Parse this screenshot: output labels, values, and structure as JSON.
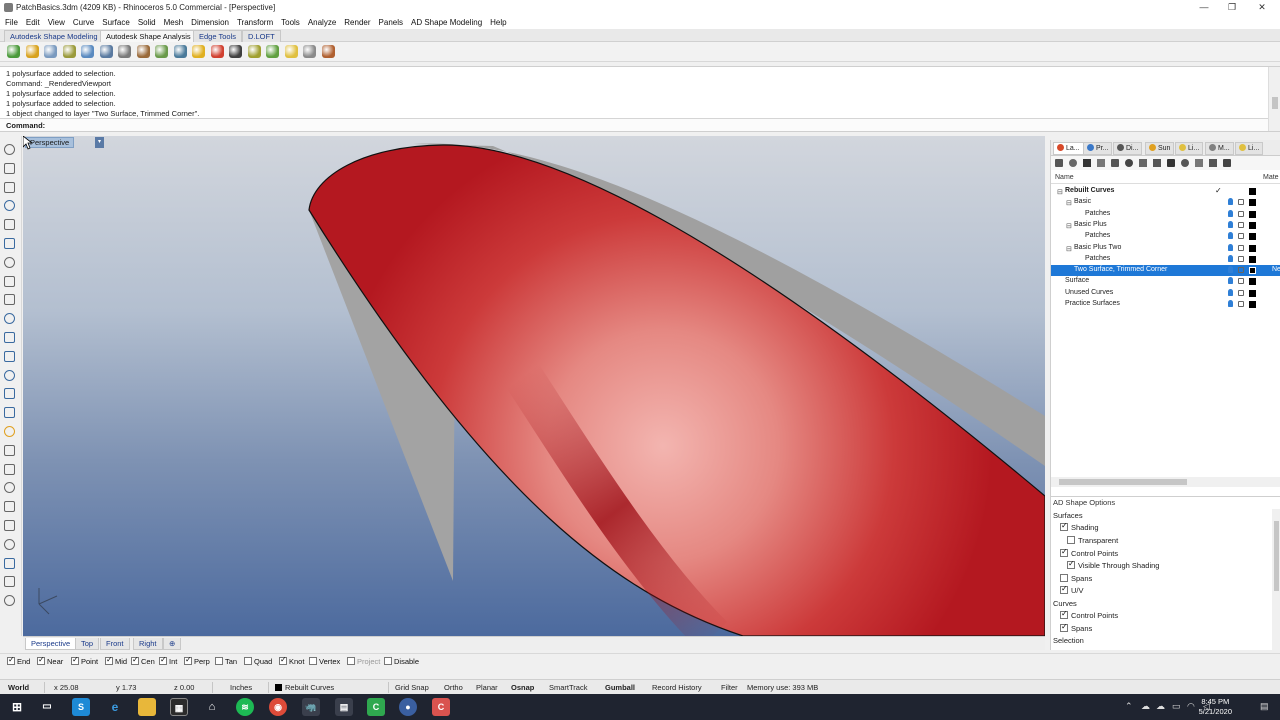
{
  "window": {
    "title": "PatchBasics.3dm (4209 KB) - Rhinoceros 5.0 Commercial - [Perspective]",
    "minimize": "—",
    "maximize": "❐",
    "close": "✕"
  },
  "menu": [
    "File",
    "Edit",
    "View",
    "Curve",
    "Surface",
    "Solid",
    "Mesh",
    "Dimension",
    "Transform",
    "Tools",
    "Analyze",
    "Render",
    "Panels",
    "AD Shape Modeling",
    "Help"
  ],
  "toolbar_tabs": [
    {
      "label": "Autodesk Shape Modeling",
      "active": false
    },
    {
      "label": "Autodesk Shape Analysis",
      "active": true
    },
    {
      "label": "Edge Tools",
      "active": false
    },
    {
      "label": "D.LOFT",
      "active": false
    }
  ],
  "command_history": [
    "1 polysurface added to selection.",
    "Command: _RenderedViewport",
    "1 polysurface added to selection.",
    "1 polysurface added to selection.",
    "1 object changed to layer \"Two Surface, Trimmed Corner\"."
  ],
  "command_prompt": "Command:",
  "viewport": {
    "label": "Perspective",
    "menu_arrow": "▾",
    "surface_color": "#b5141c",
    "side_color": "#9e9e9e"
  },
  "viewport_tabs": [
    {
      "label": "Perspective",
      "active": true
    },
    {
      "label": "Top",
      "active": false
    },
    {
      "label": "Front",
      "active": false
    },
    {
      "label": "Right",
      "active": false
    },
    {
      "label": "⊕",
      "active": false
    }
  ],
  "osnaps": [
    {
      "label": "End",
      "checked": true
    },
    {
      "label": "Near",
      "checked": true
    },
    {
      "label": "Point",
      "checked": true
    },
    {
      "label": "Mid",
      "checked": true
    },
    {
      "label": "Cen",
      "checked": true
    },
    {
      "label": "Int",
      "checked": true
    },
    {
      "label": "Perp",
      "checked": true
    },
    {
      "label": "Tan",
      "checked": false
    },
    {
      "label": "Quad",
      "checked": false
    },
    {
      "label": "Knot",
      "checked": true
    },
    {
      "label": "Vertex",
      "checked": false
    },
    {
      "label": "Project",
      "checked": false,
      "disabled": true
    },
    {
      "label": "Disable",
      "checked": false
    }
  ],
  "status": {
    "cplane": "World",
    "x": "x 25.08",
    "y": "y 1.73",
    "z": "z 0.00",
    "units": "Inches",
    "layer": "Rebuilt Curves",
    "grid_snap": "Grid Snap",
    "ortho": "Ortho",
    "planar": "Planar",
    "osnap": "Osnap",
    "smarttrack": "SmartTrack",
    "gumball": "Gumball",
    "record_history": "Record History",
    "filter": "Filter",
    "memory": "Memory use: 393 MB"
  },
  "panel_tabs": [
    {
      "label": "La...",
      "color": "#d84a2a",
      "active": true
    },
    {
      "label": "Pr...",
      "color": "#3a78c8",
      "active": false
    },
    {
      "label": "Di...",
      "color": "#555555",
      "active": false
    },
    {
      "label": "Sun",
      "color": "#e0a020",
      "active": false
    },
    {
      "label": "Li...",
      "color": "#e0c040",
      "active": false
    },
    {
      "label": "M...",
      "color": "#808080",
      "active": false
    },
    {
      "label": "Li...",
      "color": "#e0c040",
      "active": false
    }
  ],
  "layers": {
    "columns": {
      "name": "Name",
      "material": "Mate"
    },
    "rows": [
      {
        "name": "Rebuilt Curves",
        "level": 0,
        "toggle": "⊟",
        "bold": true,
        "current": true,
        "selected": false
      },
      {
        "name": "Basic",
        "level": 1,
        "toggle": "⊟",
        "bold": false,
        "current": false,
        "selected": false
      },
      {
        "name": "Patches",
        "level": 2,
        "toggle": "",
        "bold": false,
        "current": false,
        "selected": false
      },
      {
        "name": "Basic Plus",
        "level": 1,
        "toggle": "⊟",
        "bold": false,
        "current": false,
        "selected": false
      },
      {
        "name": "Patches",
        "level": 2,
        "toggle": "",
        "bold": false,
        "current": false,
        "selected": false
      },
      {
        "name": "Basic Plus Two",
        "level": 1,
        "toggle": "⊟",
        "bold": false,
        "current": false,
        "selected": false
      },
      {
        "name": "Patches",
        "level": 2,
        "toggle": "",
        "bold": false,
        "current": false,
        "selected": false
      },
      {
        "name": "Two Surface, Trimmed Corner",
        "level": 1,
        "toggle": "",
        "bold": false,
        "current": false,
        "selected": true
      },
      {
        "name": "Surface",
        "level": 0,
        "toggle": "",
        "bold": false,
        "current": false,
        "selected": false
      },
      {
        "name": "Unused Curves",
        "level": 0,
        "toggle": "",
        "bold": false,
        "current": false,
        "selected": false
      },
      {
        "name": "Practice Surfaces",
        "level": 0,
        "toggle": "",
        "bold": false,
        "current": false,
        "selected": false
      }
    ],
    "current_mark": "✓",
    "selected_material": "Ne"
  },
  "ad_shape_options": {
    "title": "AD Shape Options",
    "sections": [
      {
        "label": "Surfaces",
        "options": [
          {
            "label": "Shading",
            "checked": true,
            "indent": 0
          },
          {
            "label": "Transparent",
            "checked": false,
            "indent": 1
          },
          {
            "label": "Control Points",
            "checked": true,
            "indent": 0
          },
          {
            "label": "Visible Through Shading",
            "checked": true,
            "indent": 1
          },
          {
            "label": "Spans",
            "checked": false,
            "indent": 0
          },
          {
            "label": "U/V",
            "checked": true,
            "indent": 0
          }
        ]
      },
      {
        "label": "Curves",
        "options": [
          {
            "label": "Control Points",
            "checked": true,
            "indent": 0
          },
          {
            "label": "Spans",
            "checked": true,
            "indent": 0
          }
        ]
      },
      {
        "label": "Selection",
        "options": []
      }
    ]
  },
  "taskbar": {
    "time": "8:45 PM",
    "date": "5/21/2020"
  }
}
